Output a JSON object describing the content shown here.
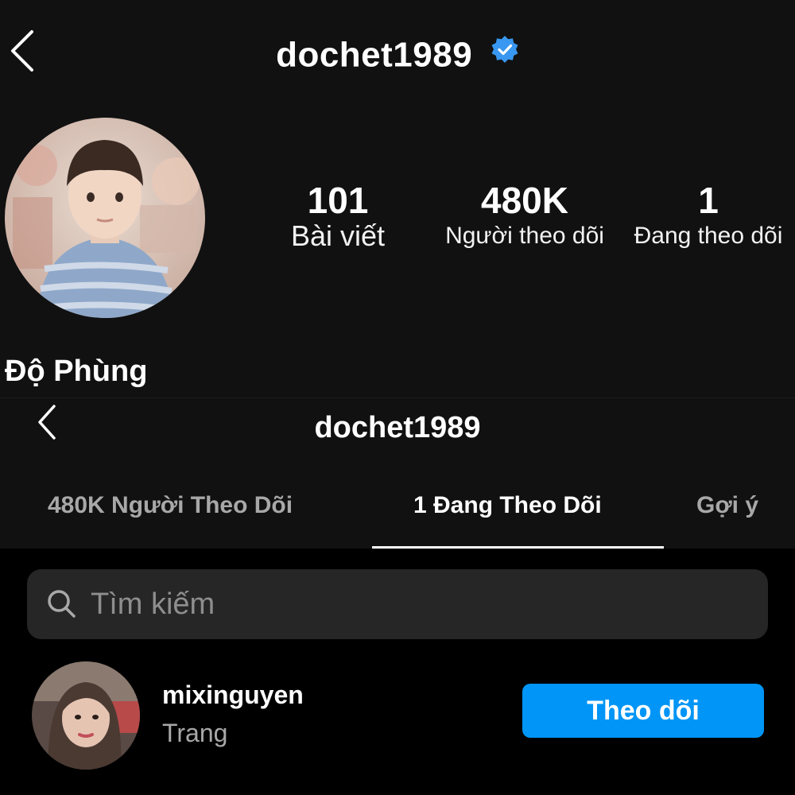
{
  "profile": {
    "username": "dochet1989",
    "verified": true,
    "display_name": "Độ Phùng",
    "stats": [
      {
        "value": "101",
        "label": "Bài viết"
      },
      {
        "value": "480K",
        "label": "Người theo dõi"
      },
      {
        "value": "1",
        "label": "Đang theo dõi"
      }
    ]
  },
  "follow_page": {
    "username": "dochet1989",
    "tabs": [
      {
        "label": "480K Người Theo Dõi",
        "active": false
      },
      {
        "label": "1 Đang Theo Dõi",
        "active": true
      },
      {
        "label": "Gợi ý",
        "active": false
      }
    ],
    "search": {
      "placeholder": "Tìm kiếm",
      "value": ""
    },
    "users": [
      {
        "username": "mixinguyen",
        "full_name": "Trang",
        "button_label": "Theo dõi"
      }
    ]
  },
  "colors": {
    "background": "#000000",
    "panel": "#111111",
    "accent": "#0095f6",
    "verified": "#3897f0",
    "muted_text": "#a8a8a8"
  }
}
